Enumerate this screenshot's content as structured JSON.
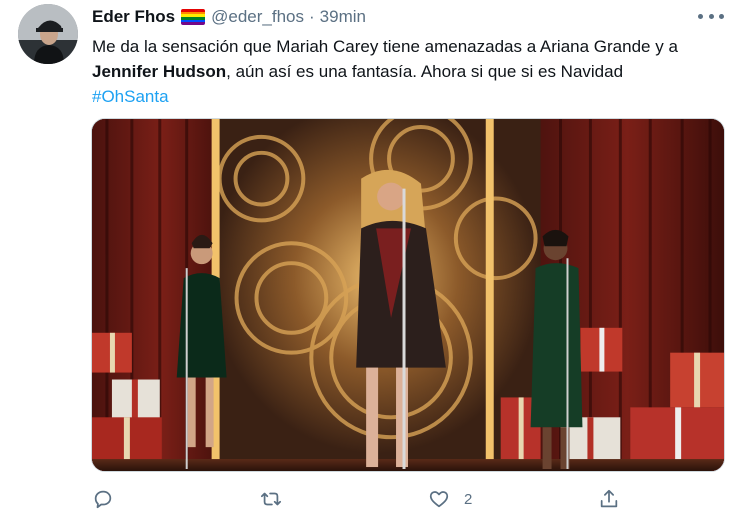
{
  "author": {
    "display_name": "Eder Fhos",
    "handle": "@eder_fhos",
    "separator": "·",
    "time": "39min",
    "flag_icon": "rainbow-flag-icon",
    "flag_colors": [
      "#e40303",
      "#ff8c00",
      "#ffed00",
      "#008026",
      "#004dff",
      "#750787"
    ]
  },
  "tweet": {
    "text_part1": "Me da la sensación que Mariah Carey tiene amenazadas a Ariana Grande y a ",
    "text_bold": "Jennifer Hudson",
    "text_part2": ", aún así es una fantasía. Ahora si que si es Navidad",
    "hashtag": "#OhSanta"
  },
  "actions": {
    "reply": {
      "icon": "reply-icon",
      "count": ""
    },
    "retweet": {
      "icon": "retweet-icon",
      "count": ""
    },
    "like": {
      "icon": "heart-icon",
      "count": "2"
    },
    "share": {
      "icon": "share-icon",
      "count": ""
    }
  },
  "colors": {
    "text": "#0f1419",
    "muted": "#5b7083",
    "link": "#1da1f2"
  }
}
